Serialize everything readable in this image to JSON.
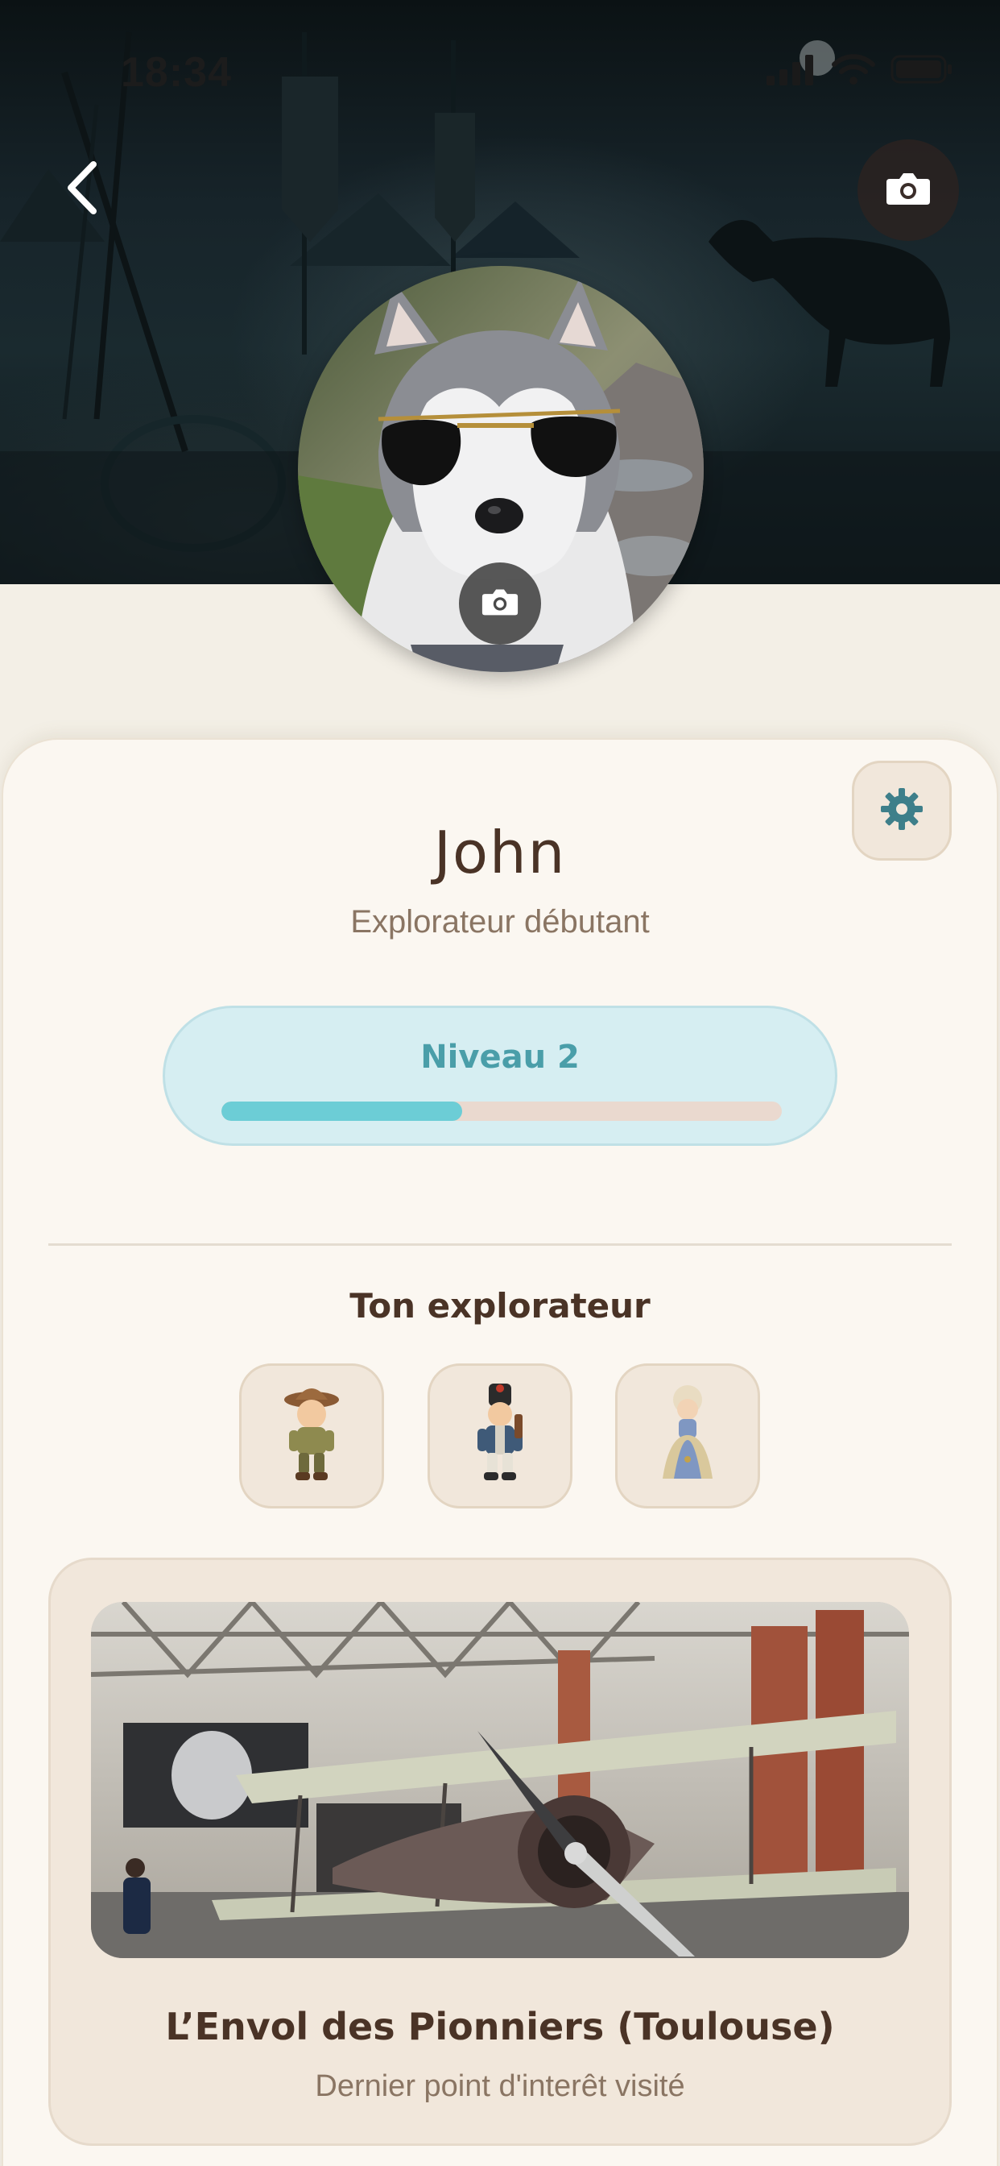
{
  "status_bar": {
    "time": "18:34",
    "icons": [
      "signal-icon",
      "wifi-icon",
      "battery-icon"
    ]
  },
  "header": {
    "back_icon": "chevron-left-icon",
    "cover_camera_icon": "camera-icon"
  },
  "avatar": {
    "description_icon": "profile-photo",
    "camera_icon": "camera-icon"
  },
  "profile": {
    "name": "John",
    "rank": "Explorateur débutant",
    "settings_icon": "gear-icon"
  },
  "level": {
    "label": "Niveau 2",
    "progress": 0.43
  },
  "explorers": {
    "title": "Ton explorateur",
    "items": [
      {
        "icon": "adventurer-figure-icon"
      },
      {
        "icon": "soldier-figure-icon"
      },
      {
        "icon": "marquise-figure-icon"
      }
    ]
  },
  "last_poi": {
    "title": "L’Envol des Pionniers (Toulouse)",
    "subtitle": "Dernier point d'interêt visité"
  },
  "colors": {
    "brand_brown": "#4a3326",
    "muted_brown": "#8a7563",
    "level_teal": "#4a9ea9",
    "progress_fill": "#6ccdd6",
    "card_bg": "#fbf7f1"
  }
}
